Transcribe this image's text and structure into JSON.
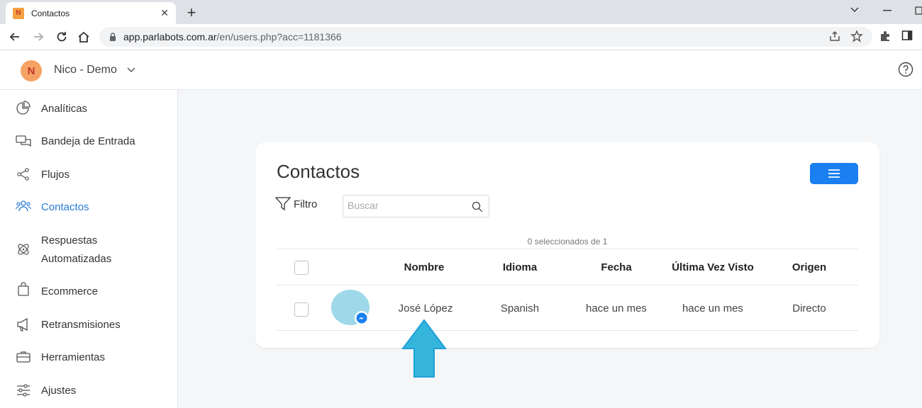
{
  "browser": {
    "tab_favicon": "N",
    "tab_title": "Contactos",
    "url_host": "app.parlabots.com.ar",
    "url_path": "/en/users.php?acc=1181366"
  },
  "header": {
    "avatar_letter": "N",
    "org_name": "Nico - Demo"
  },
  "sidebar": {
    "items": [
      {
        "label": "Analíticas",
        "icon": "pie-chart-icon"
      },
      {
        "label": "Bandeja de Entrada",
        "icon": "chat-bubbles-icon"
      },
      {
        "label": "Flujos",
        "icon": "flow-icon"
      },
      {
        "label": "Contactos",
        "icon": "users-icon",
        "active": true
      },
      {
        "label": "Respuestas",
        "label2": "Automatizadas",
        "icon": "atom-icon"
      },
      {
        "label": "Ecommerce",
        "icon": "shopping-bag-icon"
      },
      {
        "label": "Retransmisiones",
        "icon": "megaphone-icon"
      },
      {
        "label": "Herramientas",
        "icon": "briefcase-icon"
      },
      {
        "label": "Ajustes",
        "icon": "sliders-icon"
      }
    ]
  },
  "main": {
    "title": "Contactos",
    "filter_label": "Filtro",
    "search_placeholder": "Buscar",
    "selected_count": "0 seleccionados de 1",
    "columns": [
      "Nombre",
      "Idioma",
      "Fecha",
      "Última Vez Visto",
      "Origen"
    ],
    "rows": [
      {
        "name": "José López",
        "language": "Spanish",
        "date": "hace un mes",
        "last_seen": "hace un mes",
        "origin": "Directo",
        "channel": "messenger-icon"
      }
    ]
  },
  "colors": {
    "accent": "#1a7ff0",
    "active_nav": "#2a7bd4",
    "avatar_orange": "#f5a364",
    "arrow": "#35b4dc"
  }
}
